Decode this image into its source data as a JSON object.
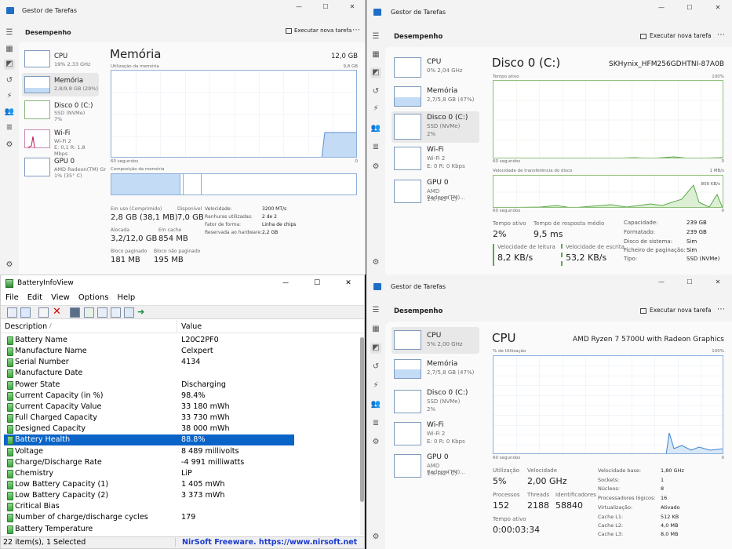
{
  "tm_title": "Gestor de Tarefas",
  "toolbar": {
    "section": "Desempenho",
    "new_task": "Executar nova tarefa",
    "more": "⋯"
  },
  "controls": {
    "min": "—",
    "max": "☐",
    "close": "✕"
  },
  "perf_items": {
    "cpu": "CPU",
    "mem": "Memória",
    "disk": "Disco 0 (C:)",
    "wifi": "Wi-Fi",
    "gpu": "GPU 0"
  },
  "w1": {
    "cpu_sub": "19% 2,33 GHz",
    "mem_sub": "2,8/9,8 GB (29%)",
    "disk_sub1": "SSD (NVMe)",
    "disk_sub2": "7%",
    "wifi_sub1": "Wi-Fi 2",
    "wifi_sub2": "E: 0,1 R: 1,8 Mbps",
    "gpu_sub1": "AMD Radeon(TM) Gr",
    "gpu_sub2": "1% (35° C)",
    "title": "Memória",
    "total": "12,0 GB",
    "usage_label": "Utilização da memória",
    "usage_max": "9,8 GB",
    "time_left": "60 segundos",
    "time_right": "0",
    "comp_label": "Composição da memória",
    "in_use_l": "Em uso (Comprimido)",
    "in_use_v": "2,8 GB (38,1 MB)",
    "avail_l": "Disponível",
    "avail_v": "7,0 GB",
    "alloc_l": "Alocada",
    "alloc_v": "3,2/12,0 GB",
    "cache_l": "Em cache",
    "cache_v": "854 MB",
    "paged_l": "Bloco paginado",
    "paged_v": "181 MB",
    "nonpaged_l": "Bloco não paginado",
    "nonpaged_v": "195 MB",
    "speed_k": "Velocidade:",
    "speed_v": "3200 MT/s",
    "slots_k": "Ranhuras utilizadas:",
    "slots_v": "2 de 2",
    "form_k": "Fator de forma:",
    "form_v": "Linha de chips",
    "hw_k": "Reservada ao hardware:",
    "hw_v": "2,2 GB",
    "mem_usage_fraction": 0.29
  },
  "w2": {
    "cpu_sub": "0% 2,04 GHz",
    "mem_sub": "2,7/5,8 GB (47%)",
    "disk_sub1": "SSD (NVMe)",
    "disk_sub2": "2%",
    "wifi_sub1": "Wi-Fi 2",
    "wifi_sub2": "E: 0 R: 0 Kbps",
    "gpu_sub1": "AMD Radeon(TM)...",
    "gpu_sub2": "1% (43° C)",
    "title": "Disco 0 (C:)",
    "model": "SKHynix_HFM256GDHTNI-87A0B",
    "active_label": "Tempo ativo",
    "active_max": "100%",
    "time_left": "60 segundos",
    "time_right": "0",
    "xfer_label": "Velocidade de transferência do disco",
    "xfer_max": "1 MB/s",
    "xfer_mark": "800 KB/s",
    "active_l": "Tempo ativo",
    "active_v": "2%",
    "resp_l": "Tempo de resposta médio",
    "resp_v": "9,5 ms",
    "read_l": "Velocidade de leitura",
    "read_v": "8,2 KB/s",
    "write_l": "Velocidade de escrita",
    "write_v": "53,2 KB/s",
    "cap_k": "Capacidade:",
    "cap_v": "239 GB",
    "fmt_k": "Formatado:",
    "fmt_v": "239 GB",
    "sys_k": "Disco de sistema:",
    "sys_v": "Sim",
    "page_k": "Ficheiro de paginação:",
    "page_v": "Sim",
    "type_k": "Tipo:",
    "type_v": "SSD (NVMe)"
  },
  "w3": {
    "cpu_sub": "5% 2,00 GHz",
    "mem_sub": "2,7/5,8 GB (47%)",
    "disk_sub1": "SSD (NVMe)",
    "disk_sub2": "2%",
    "wifi_sub1": "Wi-Fi 2",
    "wifi_sub2": "E: 0 R: 0 Kbps",
    "gpu_sub1": "AMD Radeon(TM)...",
    "gpu_sub2": "1% (42° C)",
    "title": "CPU",
    "model": "AMD Ryzen 7 5700U with Radeon Graphics",
    "usage_label": "% de Utilização",
    "usage_max": "100%",
    "time_left": "60 segundos",
    "time_right": "0",
    "util_l": "Utilização",
    "util_v": "5%",
    "speed_l": "Velocidade",
    "speed_v": "2,00 GHz",
    "proc_l": "Processos",
    "proc_v": "152",
    "thr_l": "Threads",
    "thr_v": "2188",
    "hnd_l": "Identificadores",
    "hnd_v": "58840",
    "up_l": "Tempo ativo",
    "up_v": "0:00:03:34",
    "base_k": "Velocidade base:",
    "base_v": "1,80 GHz",
    "sock_k": "Sockets:",
    "sock_v": "1",
    "core_k": "Núcleos:",
    "core_v": "8",
    "lp_k": "Processadores lógicos:",
    "lp_v": "16",
    "virt_k": "Virtualização:",
    "virt_v": "Ativado",
    "l1_k": "Cache L1:",
    "l1_v": "512 KB",
    "l2_k": "Cache L2:",
    "l2_v": "4,0 MB",
    "l3_k": "Cache L3:",
    "l3_v": "8,0 MB"
  },
  "biv": {
    "title": "BatteryInfoView",
    "menu": [
      "File",
      "Edit",
      "View",
      "Options",
      "Help"
    ],
    "col_desc": "Description",
    "col_value": "Value",
    "sort": "/",
    "rows": [
      {
        "d": "Battery Name",
        "v": "L20C2PF0"
      },
      {
        "d": "Manufacture Name",
        "v": "Celxpert"
      },
      {
        "d": "Serial Number",
        "v": " 4134"
      },
      {
        "d": "Manufacture Date",
        "v": ""
      },
      {
        "d": "Power State",
        "v": "Discharging"
      },
      {
        "d": "Current Capacity (in %)",
        "v": "98.4%"
      },
      {
        "d": "Current Capacity Value",
        "v": "33 180 mWh"
      },
      {
        "d": "Full Charged Capacity",
        "v": "33 730 mWh"
      },
      {
        "d": "Designed Capacity",
        "v": "38 000 mWh"
      },
      {
        "d": "Battery Health",
        "v": "88.8%"
      },
      {
        "d": "Voltage",
        "v": "8 489 millivolts"
      },
      {
        "d": "Charge/Discharge Rate",
        "v": "-4 991 milliwatts"
      },
      {
        "d": "Chemistry",
        "v": "LiP"
      },
      {
        "d": "Low Battery Capacity (1)",
        "v": "1 405 mWh"
      },
      {
        "d": "Low Battery Capacity (2)",
        "v": "3 373 mWh"
      },
      {
        "d": "Critical Bias",
        "v": ""
      },
      {
        "d": "Number of charge/discharge cycles",
        "v": "179"
      },
      {
        "d": "Battery Temperature",
        "v": ""
      }
    ],
    "selected_index": 9,
    "status_left": "22 item(s), 1 Selected",
    "status_right": "NirSoft Freeware. https://www.nirsoft.net"
  }
}
